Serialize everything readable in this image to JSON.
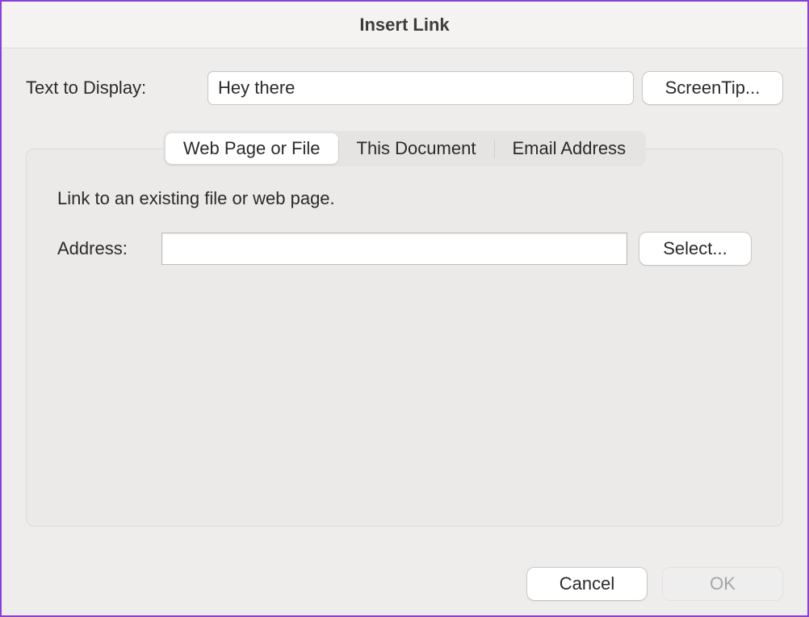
{
  "dialog": {
    "title": "Insert Link"
  },
  "display": {
    "label": "Text to Display:",
    "value": "Hey there",
    "screentip_label": "ScreenTip..."
  },
  "tabs": {
    "web": "Web Page or File",
    "doc": "This Document",
    "email": "Email Address"
  },
  "panel": {
    "description": "Link to an existing file or web page.",
    "address_label": "Address:",
    "address_value": "",
    "select_label": "Select..."
  },
  "footer": {
    "cancel": "Cancel",
    "ok": "OK"
  }
}
